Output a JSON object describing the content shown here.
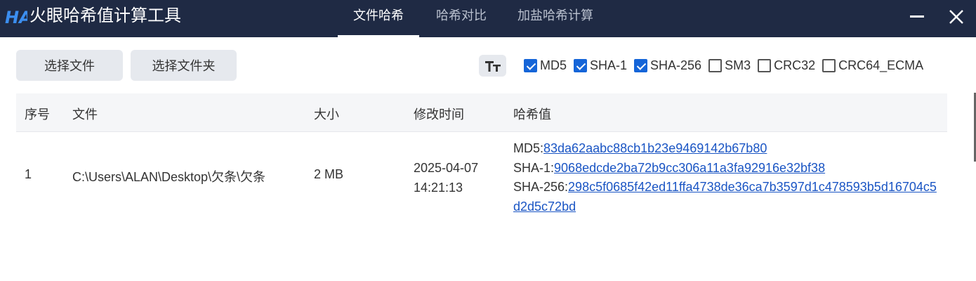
{
  "app": {
    "title": "火眼哈希值计算工具",
    "logo_text": "HA"
  },
  "tabs": [
    {
      "label": "文件哈希",
      "active": true
    },
    {
      "label": "哈希对比",
      "active": false
    },
    {
      "label": "加盐哈希计算",
      "active": false
    }
  ],
  "toolbar": {
    "select_file_label": "选择文件",
    "select_folder_label": "选择文件夹",
    "font_button_label": "Tт"
  },
  "algorithms": [
    {
      "label": "MD5",
      "checked": true
    },
    {
      "label": "SHA-1",
      "checked": true
    },
    {
      "label": "SHA-256",
      "checked": true
    },
    {
      "label": "SM3",
      "checked": false
    },
    {
      "label": "CRC32",
      "checked": false
    },
    {
      "label": "CRC64_ECMA",
      "checked": false
    }
  ],
  "table": {
    "columns": [
      "序号",
      "文件",
      "大小",
      "修改时间",
      "哈希值"
    ],
    "rows": [
      {
        "index": "1",
        "file": "C:\\Users\\ALAN\\Desktop\\欠条\\欠条",
        "size": "2 MB",
        "modified_date": "2025-04-07",
        "modified_time": "14:21:13",
        "hashes": [
          {
            "label": "MD5:",
            "value": "83da62aabc88cb1b23e9469142b67b80"
          },
          {
            "label": "SHA-1:",
            "value": "9068edcde2ba72b9cc306a11a3fa92916e32bf38"
          },
          {
            "label": "SHA-256:",
            "value": "298c5f0685f42ed11ffa4738de36ca7b3597d1c478593b5d16704c5d2d5c72bd"
          }
        ]
      }
    ]
  },
  "colors": {
    "titlebar": "#1f2a44",
    "accent": "#1565d8",
    "link": "#1a55c4",
    "logo": "#3b8ef0"
  }
}
